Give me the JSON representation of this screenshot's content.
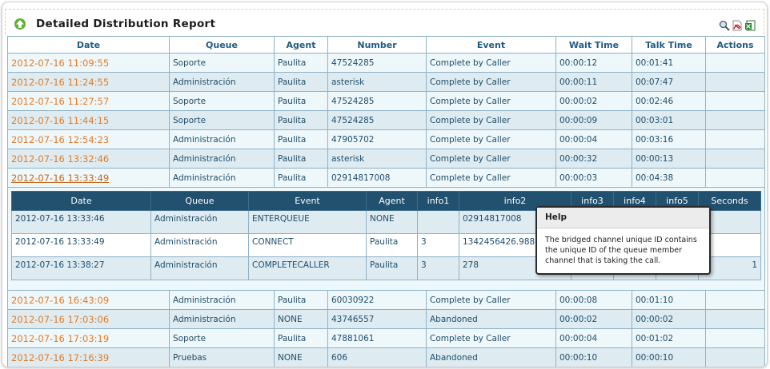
{
  "header": {
    "title": "Detailed Distribution Report"
  },
  "icons": {
    "up": "up-arrow-icon",
    "zoom": "zoom-icon",
    "pdf": "pdf-export-icon",
    "excel": "excel-export-icon"
  },
  "columns": [
    "Date",
    "Queue",
    "Agent",
    "Number",
    "Event",
    "Wait Time",
    "Talk Time",
    "Actions"
  ],
  "rows_before": [
    {
      "date": "2012-07-16 11:09:55",
      "queue": "Soporte",
      "agent": "Paulita",
      "number": "47524285",
      "event": "Complete by Caller",
      "wait": "00:00:12",
      "talk": "00:01:41"
    },
    {
      "date": "2012-07-16 11:24:55",
      "queue": "Administración",
      "agent": "Paulita",
      "number": "asterisk",
      "event": "Complete by Caller",
      "wait": "00:00:11",
      "talk": "00:07:47"
    },
    {
      "date": "2012-07-16 11:27:57",
      "queue": "Soporte",
      "agent": "Paulita",
      "number": "47524285",
      "event": "Complete by Caller",
      "wait": "00:00:02",
      "talk": "00:02:46"
    },
    {
      "date": "2012-07-16 11:44:15",
      "queue": "Soporte",
      "agent": "Paulita",
      "number": "47524285",
      "event": "Complete by Caller",
      "wait": "00:00:09",
      "talk": "00:03:01"
    },
    {
      "date": "2012-07-16 12:54:23",
      "queue": "Administración",
      "agent": "Paulita",
      "number": "47905702",
      "event": "Complete by Caller",
      "wait": "00:00:04",
      "talk": "00:03:16"
    },
    {
      "date": "2012-07-16 13:32:46",
      "queue": "Administración",
      "agent": "Paulita",
      "number": "asterisk",
      "event": "Complete by Caller",
      "wait": "00:00:32",
      "talk": "00:00:13"
    },
    {
      "date": "2012-07-16 13:33:49",
      "queue": "Administración",
      "agent": "Paulita",
      "number": "02914817008",
      "event": "Complete by Caller",
      "wait": "00:00:03",
      "talk": "00:04:38"
    }
  ],
  "detail_columns": [
    "Date",
    "Queue",
    "Event",
    "Agent",
    "info1",
    "info2",
    "info3",
    "info4",
    "info5",
    "Seconds"
  ],
  "detail_rows": [
    {
      "date": "2012-07-16 13:33:46",
      "queue": "Administración",
      "event": "ENTERQUEUE",
      "agent": "NONE",
      "info1": "",
      "info2": "02914817008",
      "info3": "",
      "info4": "",
      "info5": "",
      "seconds": ""
    },
    {
      "date": "2012-07-16 13:33:49",
      "queue": "Administración",
      "event": "CONNECT",
      "agent": "Paulita",
      "info1": "3",
      "info2": "1342456426.988",
      "info3": "",
      "info4": "",
      "info5": "",
      "seconds": ""
    },
    {
      "date": "2012-07-16 13:38:27",
      "queue": "Administración",
      "event": "COMPLETECALLER",
      "agent": "Paulita",
      "info1": "3",
      "info2": "278",
      "info3": "",
      "info4": "",
      "info5": "",
      "seconds": "1"
    }
  ],
  "rows_after": [
    {
      "date": "2012-07-16 16:43:09",
      "queue": "Administración",
      "agent": "Paulita",
      "number": "60030922",
      "event": "Complete by Caller",
      "wait": "00:00:08",
      "talk": "00:01:10"
    },
    {
      "date": "2012-07-16 17:03:06",
      "queue": "Administración",
      "agent": "NONE",
      "number": "43746557",
      "event": "Abandoned",
      "wait": "00:00:02",
      "talk": "00:00:02"
    },
    {
      "date": "2012-07-16 17:03:19",
      "queue": "Soporte",
      "agent": "Paulita",
      "number": "47881061",
      "event": "Complete by Caller",
      "wait": "00:00:04",
      "talk": "00:01:02"
    },
    {
      "date": "2012-07-16 17:16:39",
      "queue": "Pruebas",
      "agent": "NONE",
      "number": "606",
      "event": "Abandoned",
      "wait": "00:00:10",
      "talk": "00:00:10"
    }
  ],
  "tooltip": {
    "title": "Help",
    "body": "The bridged channel unique ID contains the unique ID of the queue member channel that is taking the call."
  },
  "colors": {
    "header_bg": "#22506f",
    "date_link": "#e07d2a",
    "row_alt": "#deebf1",
    "row": "#eef7fa"
  }
}
